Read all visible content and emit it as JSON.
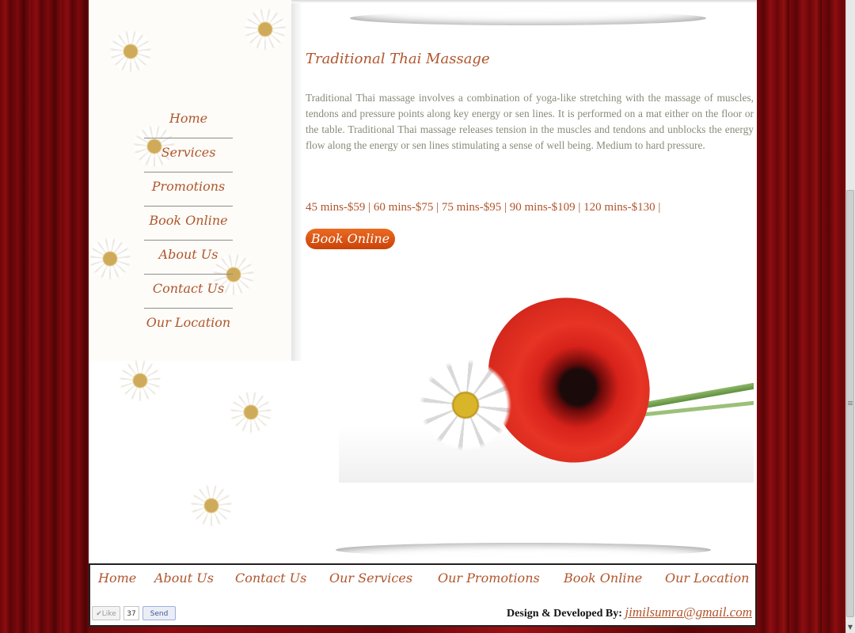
{
  "nav": {
    "items": [
      "Home",
      "Services",
      "Promotions",
      "Book Online",
      "About Us",
      "Contact Us",
      "Our Location"
    ]
  },
  "content": {
    "title": "Traditional Thai Massage",
    "description": "Traditional Thai massage involves a combination of yoga-like stretching with the massage of muscles, tendons and pressure points along key energy or sen lines. It is performed on a mat either on the floor or the table. Traditional Thai massage releases tension in the muscles and tendons and unblocks the energy flow along the energy or sen lines stimulating a sense of well being. Medium to hard pressure.",
    "prices": "45 mins-$59 | 60 mins-$75 | 75 mins-$95 | 90 mins-$109 | 120 mins-$130 |",
    "book_button": "Book Online"
  },
  "footer": {
    "links": [
      "Home",
      "About Us",
      "Contact Us",
      "Our Services",
      "Our Promotions",
      "Book Online",
      "Our Location"
    ],
    "like_label": "✔Like",
    "like_count": "37",
    "send_label": "Send",
    "credit_label": "Design & Developed By:",
    "credit_email": "jimilsumra@gmail.com"
  },
  "colors": {
    "accent": "#b0552c",
    "button": "#d9531a",
    "background_wood": "#7a080c"
  }
}
